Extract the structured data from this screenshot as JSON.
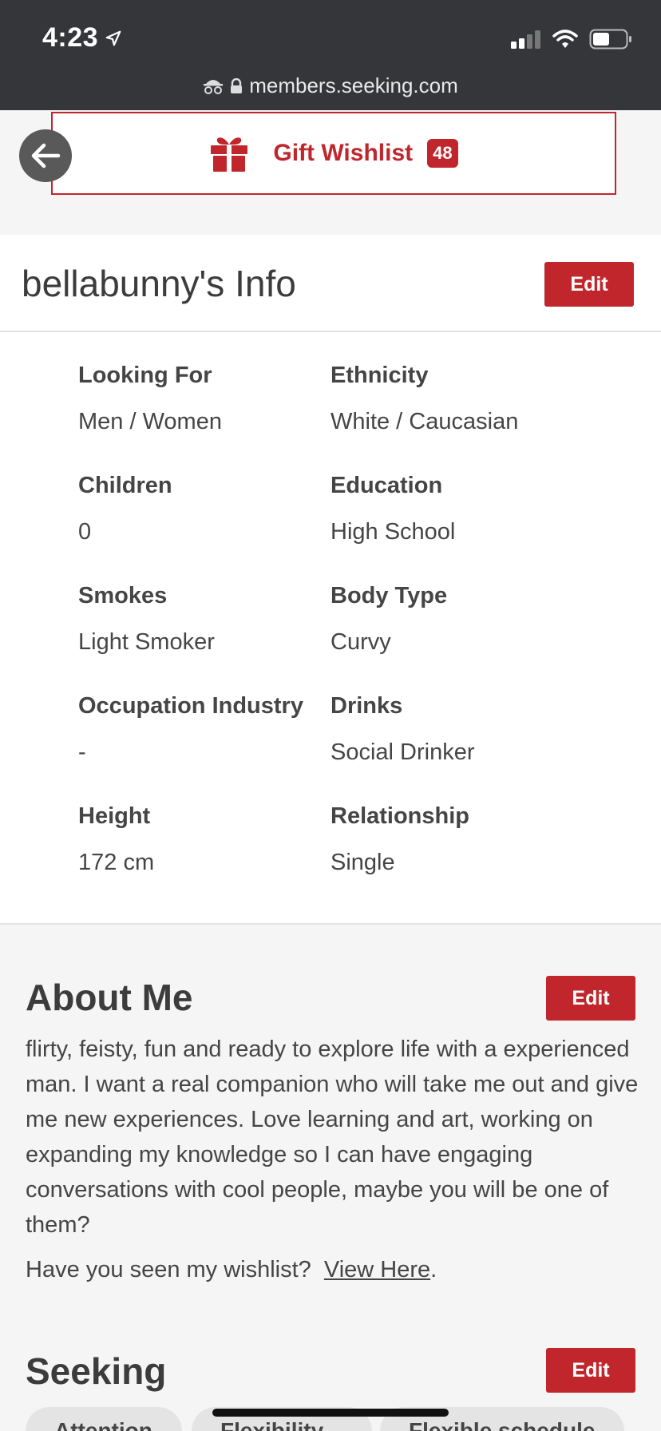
{
  "status": {
    "time": "4:23"
  },
  "browser": {
    "url": "members.seeking.com"
  },
  "wishlist": {
    "label": "Gift Wishlist",
    "count": "48"
  },
  "info": {
    "title": "bellabunny's Info",
    "edit_label": "Edit",
    "fields": [
      {
        "label": "Looking For",
        "value": "Men / Women"
      },
      {
        "label": "Ethnicity",
        "value": "White / Caucasian"
      },
      {
        "label": "Children",
        "value": "0"
      },
      {
        "label": "Education",
        "value": "High School"
      },
      {
        "label": "Smokes",
        "value": "Light Smoker"
      },
      {
        "label": "Body Type",
        "value": "Curvy"
      },
      {
        "label": "Occupation Industry",
        "value": "-"
      },
      {
        "label": "Drinks",
        "value": "Social Drinker"
      },
      {
        "label": "Height",
        "value": "172 cm"
      },
      {
        "label": "Relationship",
        "value": "Single"
      }
    ]
  },
  "about": {
    "title": "About Me",
    "edit_label": "Edit",
    "text": "flirty, feisty, fun and ready to explore life with a experienced man. I want a real companion who will take me out and give me new experiences. Love learning and art, working on expanding my knowledge so I can have engaging conversations with cool people, maybe you will be one of them?",
    "wishlist_prompt": "Have you seen my wishlist?",
    "wishlist_link": "View Here",
    "wishlist_suffix": "."
  },
  "seeking": {
    "title": "Seeking",
    "edit_label": "Edit",
    "chips": [
      "Attention",
      "Flexibility",
      "Flexible schedule"
    ]
  },
  "colors": {
    "accent": "#c0262b",
    "chrome": "#35363a"
  }
}
